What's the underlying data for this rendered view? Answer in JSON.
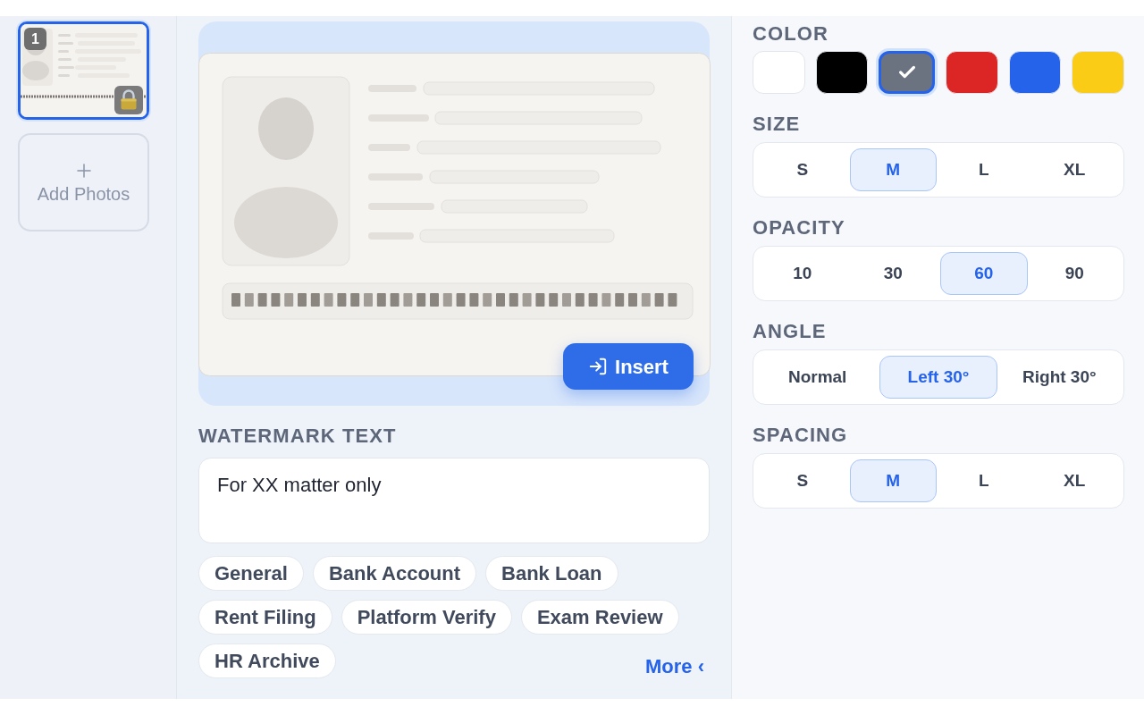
{
  "thumbnails": [
    {
      "number": "1",
      "selected": true,
      "locked": true
    }
  ],
  "add_photos_button": {
    "label": "Add Photos"
  },
  "preview": {
    "insert_button": {
      "label": "Insert"
    }
  },
  "watermark_text": {
    "label": "WATERMARK TEXT",
    "value": "For XX matter only"
  },
  "presets": [
    "General",
    "Bank Account",
    "Bank Loan",
    "Rent Filing",
    "Platform Verify",
    "Exam Review",
    "HR Archive"
  ],
  "more_link": {
    "label": "More ‹"
  },
  "color": {
    "label": "COLOR",
    "swatches": [
      {
        "color": "#ffffff",
        "selected": false
      },
      {
        "color": "#000000",
        "selected": false
      },
      {
        "color": "#6b7280",
        "selected": true
      },
      {
        "color": "#dc2626",
        "selected": false
      },
      {
        "color": "#2563eb",
        "selected": false
      },
      {
        "color": "#facc15",
        "selected": false
      }
    ]
  },
  "option_groups": [
    {
      "label": "SIZE",
      "options": [
        {
          "label": "S",
          "selected": false
        },
        {
          "label": "M",
          "selected": true
        },
        {
          "label": "L",
          "selected": false
        },
        {
          "label": "XL",
          "selected": false
        }
      ]
    },
    {
      "label": "OPACITY",
      "options": [
        {
          "label": "10",
          "selected": false
        },
        {
          "label": "30",
          "selected": false
        },
        {
          "label": "60",
          "selected": true
        },
        {
          "label": "90",
          "selected": false
        }
      ]
    },
    {
      "label": "ANGLE",
      "options": [
        {
          "label": "Normal",
          "selected": false
        },
        {
          "label": "Left 30°",
          "selected": true
        },
        {
          "label": "Right 30°",
          "selected": false
        }
      ]
    },
    {
      "label": "SPACING",
      "options": [
        {
          "label": "S",
          "selected": false
        },
        {
          "label": "M",
          "selected": true
        },
        {
          "label": "L",
          "selected": false
        },
        {
          "label": "XL",
          "selected": false
        }
      ]
    }
  ]
}
